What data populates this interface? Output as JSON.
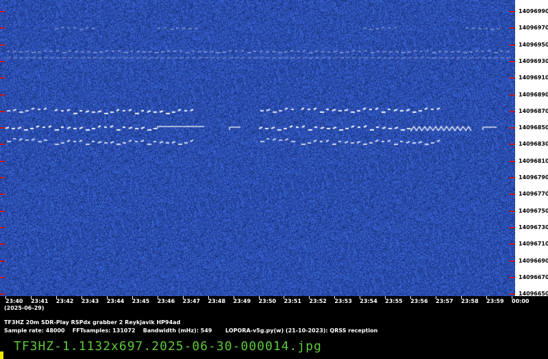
{
  "frequency_labels": [
    "14096990",
    "14096970",
    "14096950",
    "14096930",
    "14096910",
    "14096890",
    "14096870",
    "14096850",
    "14096830",
    "14096810",
    "14096790",
    "14096770",
    "14096750",
    "14096730",
    "14096710",
    "14096690",
    "14096670",
    "14096650"
  ],
  "time_labels": [
    "23:40",
    "23:41",
    "23:42",
    "23:43",
    "23:44",
    "23:45",
    "23:46",
    "23:47",
    "23:48",
    "23:49",
    "23:50",
    "23:51",
    "23:52",
    "23:53",
    "23:54",
    "23:55",
    "23:56",
    "23:57",
    "23:58",
    "23:59",
    "00:00"
  ],
  "date_label": "(2025-06-29)",
  "info": {
    "line1": "TF3HZ 20m SDR-Play RSPdx grabber 2 Reykjavik HP94ad",
    "sample_rate": "Sample rate: 48000",
    "fft_samples": "FFTsamples: 131072",
    "bandwidth": "Bandwidth (mHz): 549",
    "software": "LOPORA-v5g.py(w) (21-10-2023): QRSS reception"
  },
  "filename": "TF3HZ-1.1132x697.2025-06-30-000014.jpg",
  "colors": {
    "background": "#1e3c8c",
    "signal": "#ffffff",
    "tick": "#c4171a",
    "filename": "#5ec83a",
    "cursor": "#e8e800"
  }
}
